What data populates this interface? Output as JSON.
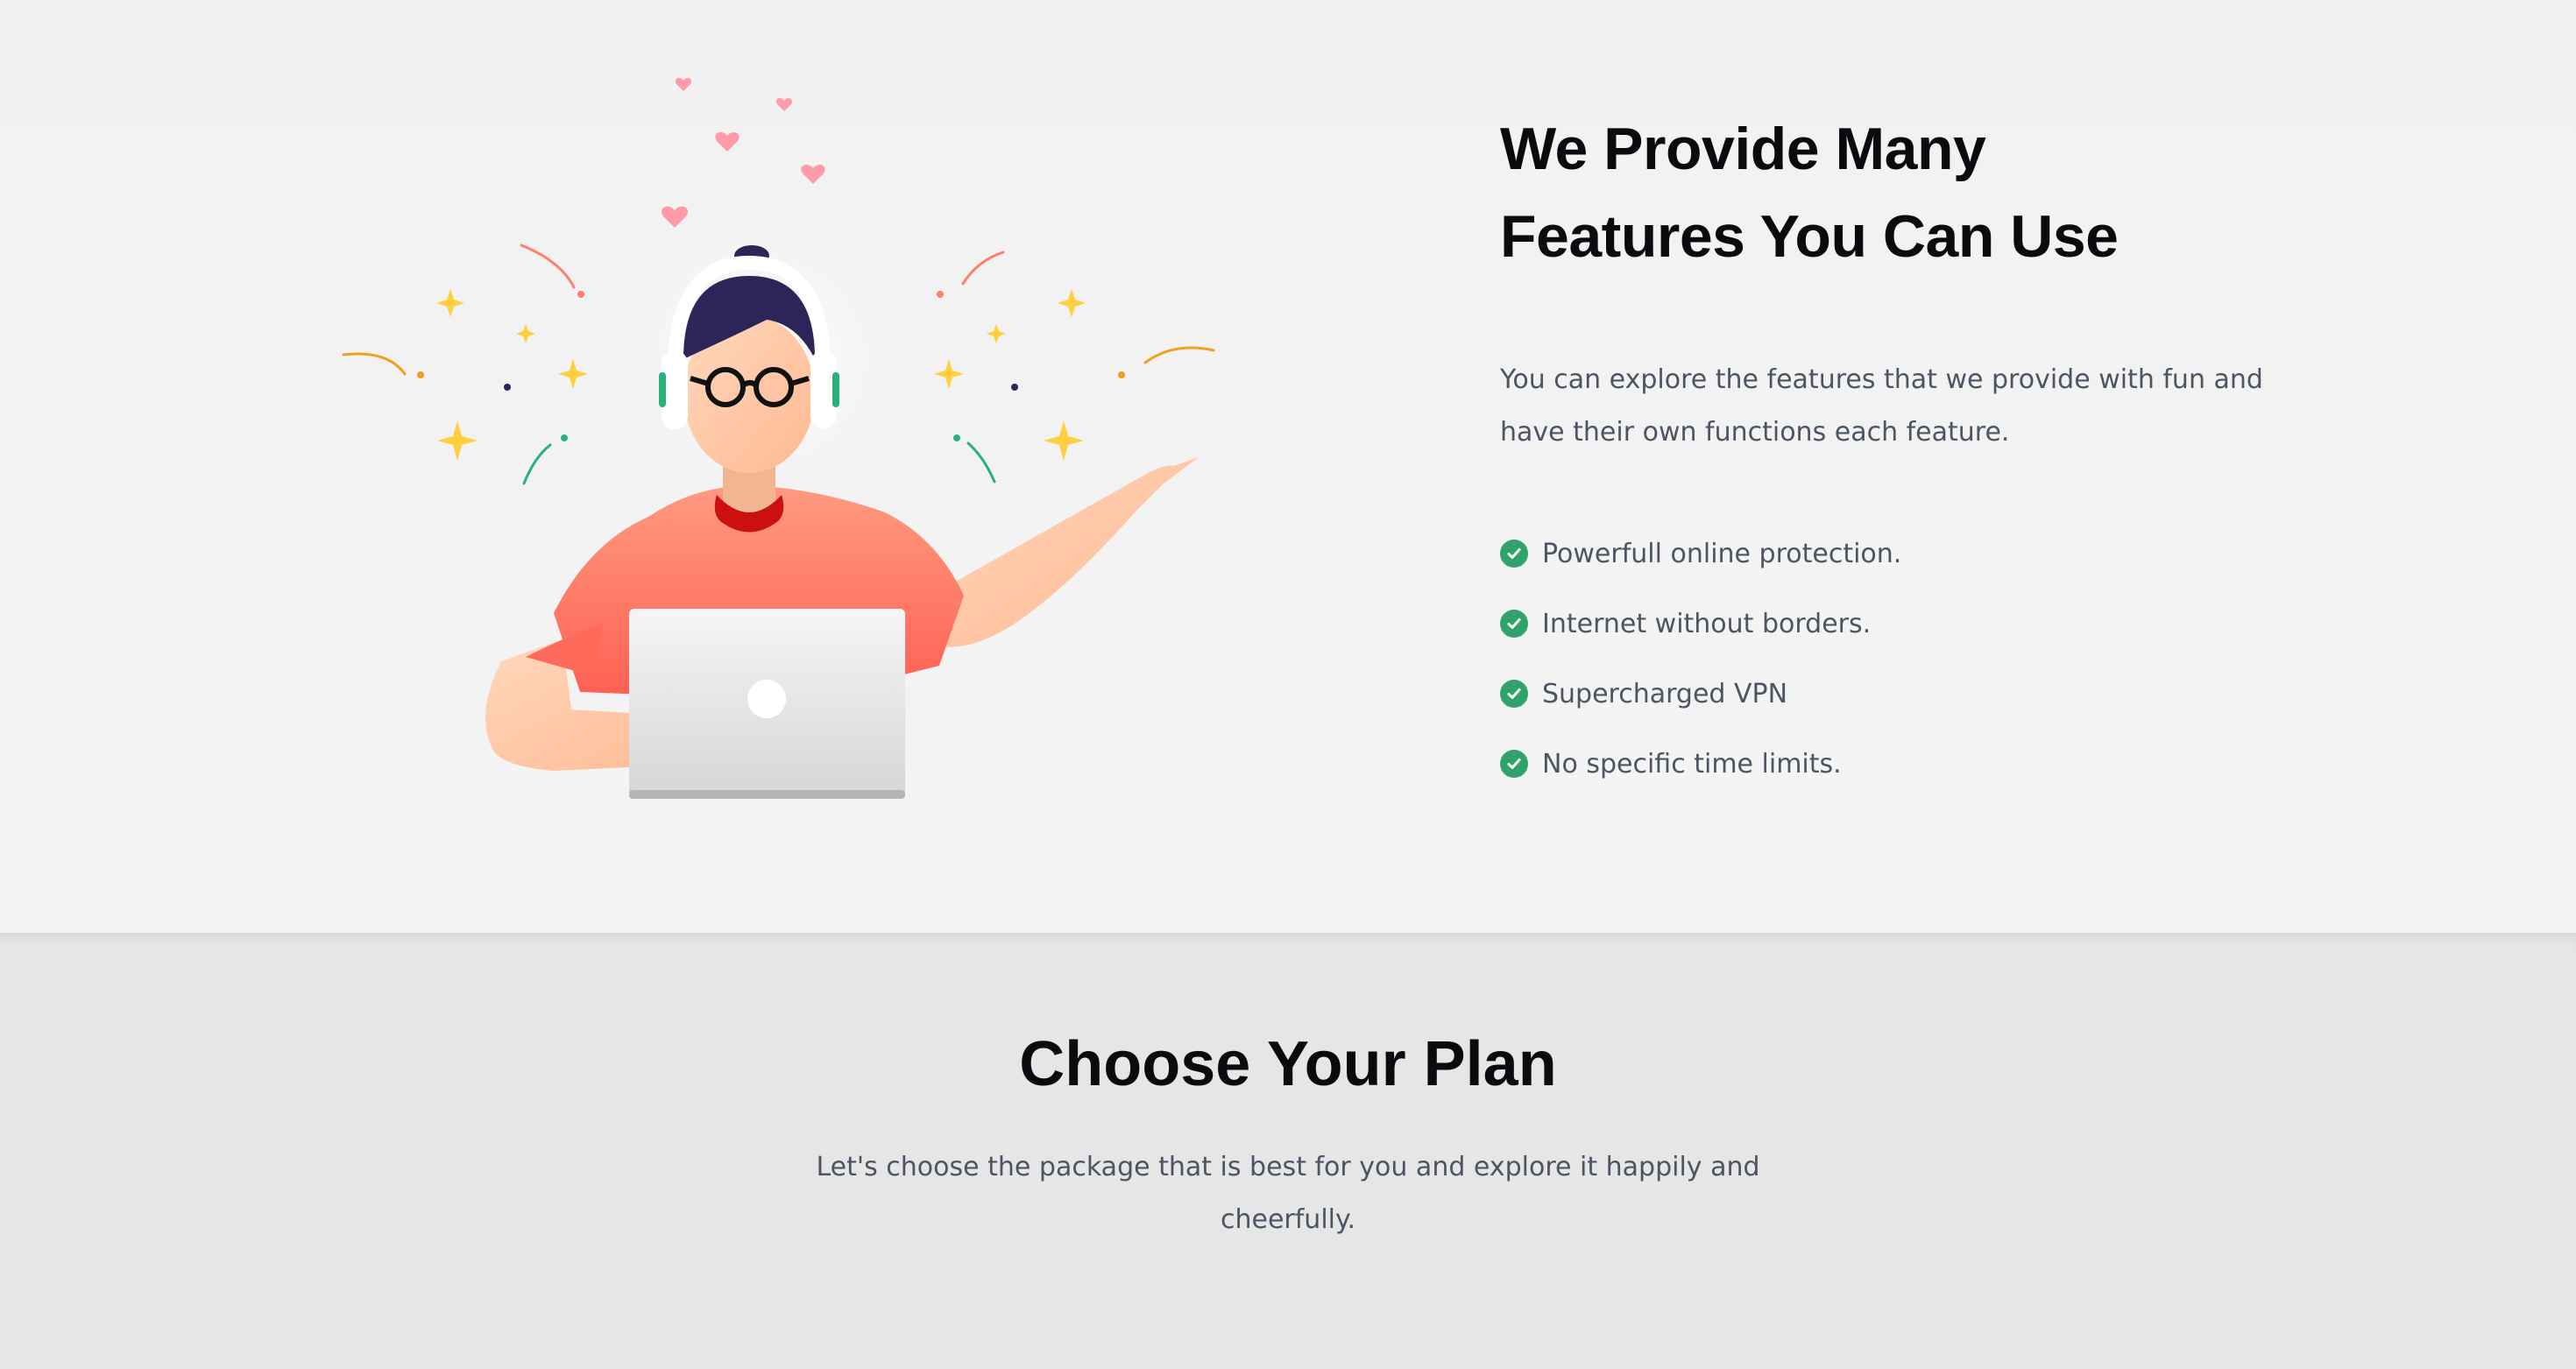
{
  "features": {
    "title_line1": "We Provide Many",
    "title_line2": "Features You Can Use",
    "description": "You can explore the features that we provide with fun and have their own functions each feature.",
    "items": [
      {
        "label": "Powerfull online protection.",
        "icon": "check-circle-icon"
      },
      {
        "label": "Internet without borders.",
        "icon": "check-circle-icon"
      },
      {
        "label": "Supercharged VPN",
        "icon": "check-circle-icon"
      },
      {
        "label": "No specific time limits.",
        "icon": "check-circle-icon"
      }
    ],
    "illustration": "person-with-headphones-and-laptop-illustration"
  },
  "plan": {
    "title": "Choose Your Plan",
    "description": "Let's choose the package that is best for you and explore it happily and cheerfully."
  },
  "colors": {
    "check_green": "#2fa36b",
    "heading": "#0b0b0f",
    "body_text": "#4b5563",
    "plan_background": "#e6e6e6",
    "shirt": "#ff7b66",
    "hair": "#2b2558"
  }
}
